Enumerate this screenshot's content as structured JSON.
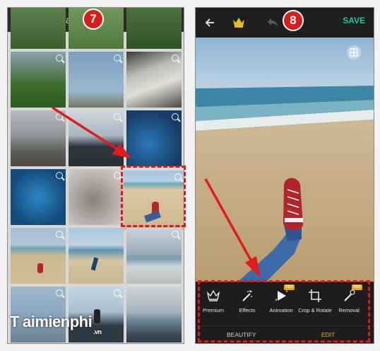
{
  "left": {
    "title": "Camera",
    "step": "7"
  },
  "right": {
    "save_label": "SAVE",
    "step": "8",
    "tools": [
      {
        "label": "Premium",
        "try": ""
      },
      {
        "label": "Effects",
        "try": ""
      },
      {
        "label": "Animation",
        "try": "TRY"
      },
      {
        "label": "Crop & Rotate",
        "try": ""
      },
      {
        "label": "Removal",
        "try": "TRY"
      }
    ],
    "tabs": {
      "beautify": "BEAUTIFY",
      "edit": "EDIT"
    }
  },
  "watermark": {
    "brand": "aimienphi",
    "tld": ".vn"
  },
  "colors": {
    "accent": "#27c3a3",
    "highlight": "#e01818",
    "edit_tab": "#e9b91a",
    "crown": "#e7c11b"
  }
}
